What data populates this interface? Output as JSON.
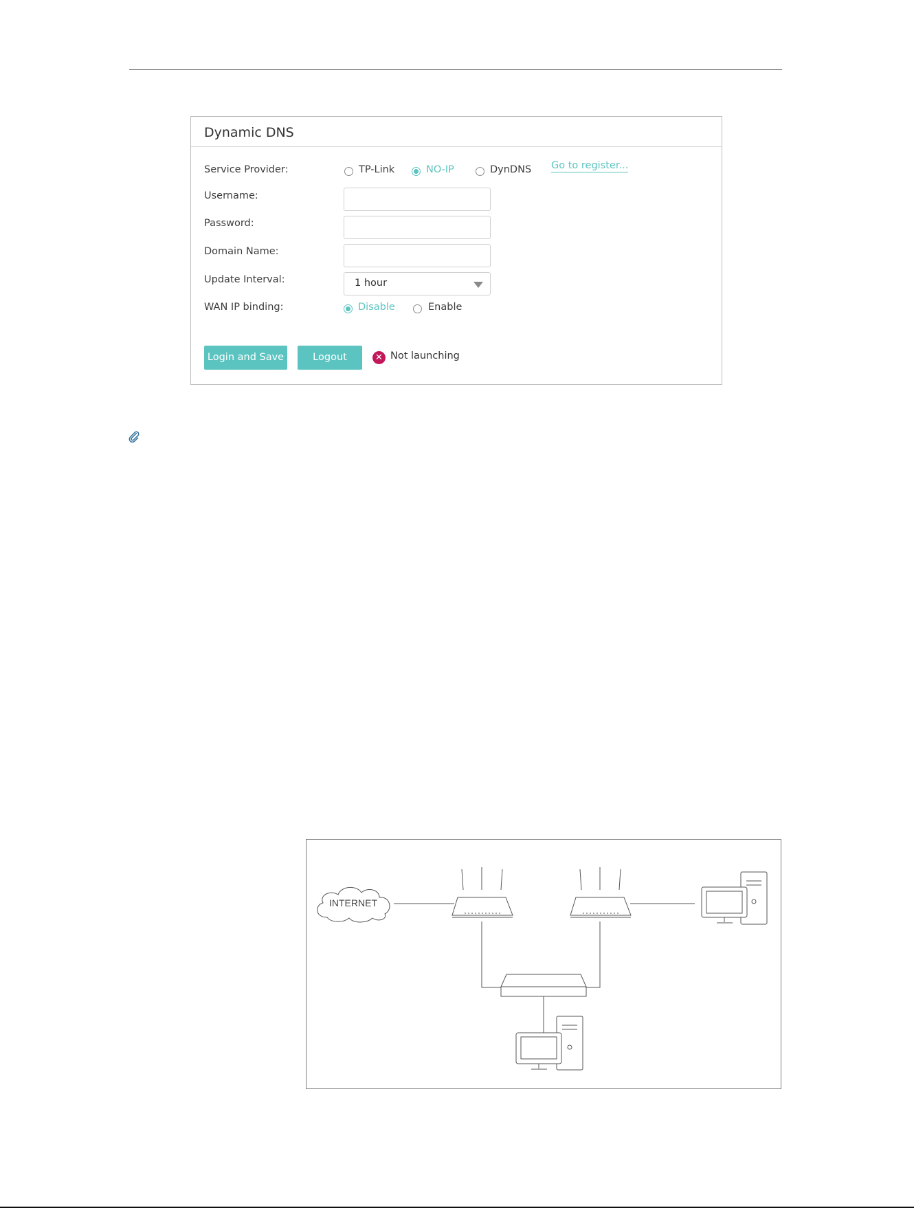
{
  "ddns": {
    "title": "Dynamic DNS",
    "service_provider_label": "Service Provider:",
    "providers": [
      "TP-Link",
      "NO-IP",
      "DynDNS"
    ],
    "selected_provider": "NO-IP",
    "register_link": "Go to register...",
    "username_label": "Username:",
    "password_label": "Password:",
    "domain_label": "Domain Name:",
    "interval_label": "Update Interval:",
    "interval_value": "1 hour",
    "wan_binding_label": "WAN IP binding:",
    "wan_binding_options": [
      "Disable",
      "Enable"
    ],
    "wan_binding_selected": "Disable",
    "login_button": "Login and Save",
    "logout_button": "Logout",
    "status_text": "Not launching"
  },
  "diagram": {
    "internet_label": "INTERNET"
  },
  "colors": {
    "accent": "#5bc4c0",
    "error": "#c2185b",
    "border": "#bdbdbd"
  },
  "icons": [
    "attachment-icon",
    "error-icon",
    "dropdown-caret-icon",
    "cloud-icon",
    "router-icon",
    "switch-icon",
    "computer-icon"
  ]
}
